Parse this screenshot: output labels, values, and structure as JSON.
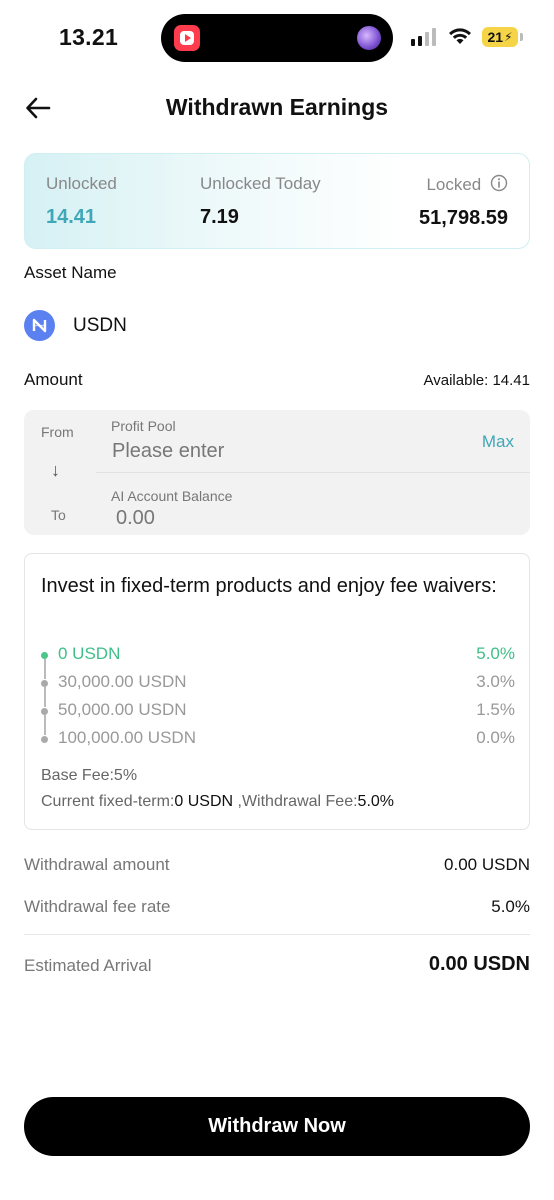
{
  "status_bar": {
    "time": "13.21",
    "battery": "21"
  },
  "header": {
    "title": "Withdrawn Earnings"
  },
  "summary": {
    "unlocked_label": "Unlocked",
    "unlocked_value": "14.41",
    "unlocked_today_label": "Unlocked Today",
    "unlocked_today_value": "7.19",
    "locked_label": "Locked",
    "locked_value": "51,798.59"
  },
  "asset": {
    "label": "Asset Name",
    "name": "USDN",
    "icon": "usdn-coin-icon"
  },
  "amount": {
    "label": "Amount",
    "available": "Available: 14.41"
  },
  "transfer": {
    "from_label": "From",
    "to_label": "To",
    "arrow": "↓",
    "pool_label": "Profit Pool",
    "input_placeholder": "Please enter",
    "max_label": "Max",
    "balance_label": "AI Account Balance",
    "balance_value": "0.00"
  },
  "fee_card": {
    "title": "Invest in fixed-term products and enjoy fee waivers:",
    "tiers": [
      {
        "amount": "0 USDN",
        "rate": "5.0%",
        "active": true
      },
      {
        "amount": "30,000.00 USDN",
        "rate": "3.0%",
        "active": false
      },
      {
        "amount": "50,000.00 USDN",
        "rate": "1.5%",
        "active": false
      },
      {
        "amount": "100,000.00 USDN",
        "rate": "0.0%",
        "active": false
      }
    ],
    "base_fee": "Base Fee:5%",
    "current_prefix": "Current fixed-term:",
    "current_amount": "0 USDN",
    "fee_prefix": " ,Withdrawal Fee:",
    "fee_value": "5.0%"
  },
  "details": {
    "withdrawal_amount_label": "Withdrawal amount",
    "withdrawal_amount_value": "0.00 USDN",
    "fee_rate_label": "Withdrawal fee rate",
    "fee_rate_value": "5.0%",
    "arrival_label": "Estimated Arrival",
    "arrival_value": "0.00 USDN"
  },
  "actions": {
    "withdraw_label": "Withdraw Now"
  },
  "colors": {
    "accent": "#3fa7b8",
    "active_tier": "#3fbf88",
    "button": "#000000"
  }
}
